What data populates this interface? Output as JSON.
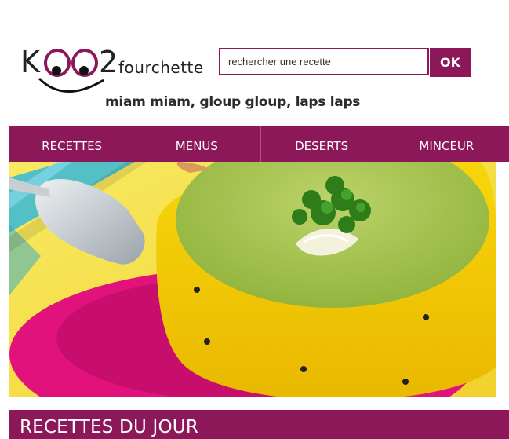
{
  "brand": {
    "logo_text": "KOO2",
    "logo_suffix": "fourchette",
    "tagline": "miam miam, gloup gloup, laps laps"
  },
  "search": {
    "placeholder": "rechercher une recette",
    "button_label": "OK"
  },
  "nav": {
    "items": [
      {
        "label": "RECETTES"
      },
      {
        "label": "MENUS"
      },
      {
        "label": "DESERTS"
      },
      {
        "label": "MINCEUR"
      }
    ]
  },
  "hero": {
    "image": "soup-bowl-photo"
  },
  "section": {
    "title": "RECETTES DU JOUR"
  },
  "colors": {
    "brand": "#8c1859",
    "nav_separator": "#c24a8c"
  }
}
